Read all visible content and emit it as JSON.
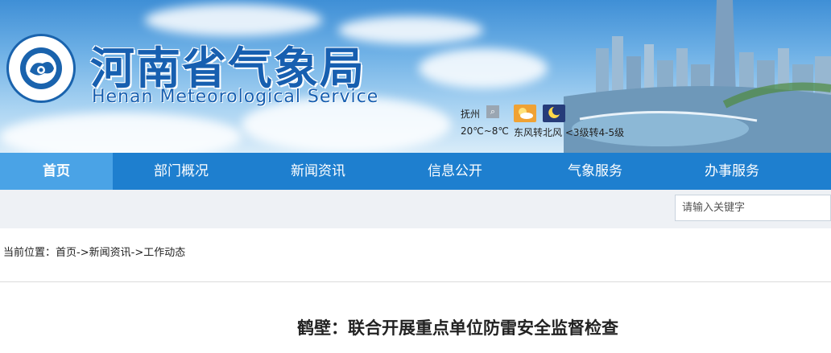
{
  "header": {
    "title_cn": "河南省气象局",
    "title_en": "Henan  Meteorological  Service",
    "logo_ring_text": "中国气象",
    "logo_ring_text_en": "CHINA METEOROLOGY"
  },
  "weather": {
    "city": "抚州",
    "temperature": "20℃~8℃",
    "wind": "东风转北风 <3级转4-5级",
    "search_icon": "magnifier-icon",
    "day_icon": "partly-cloudy-sun-icon",
    "night_icon": "moon-cloud-icon"
  },
  "nav": {
    "items": [
      {
        "label": "首页",
        "active": true
      },
      {
        "label": "部门概况",
        "active": false
      },
      {
        "label": "新闻资讯",
        "active": false
      },
      {
        "label": "信息公开",
        "active": false
      },
      {
        "label": "气象服务",
        "active": false
      },
      {
        "label": "办事服务",
        "active": false
      }
    ]
  },
  "search": {
    "placeholder": "请输入关键字"
  },
  "breadcrumb": {
    "prefix": "当前位置：",
    "items": [
      "首页",
      "新闻资讯",
      "工作动态"
    ],
    "separator": "->"
  },
  "article": {
    "title": "鹤壁：联合开展重点单位防雷安全监督检查"
  },
  "colors": {
    "nav_bg": "#1e7fcf",
    "nav_active_bg": "#4aa3e6",
    "title_blue": "#175fb0"
  }
}
